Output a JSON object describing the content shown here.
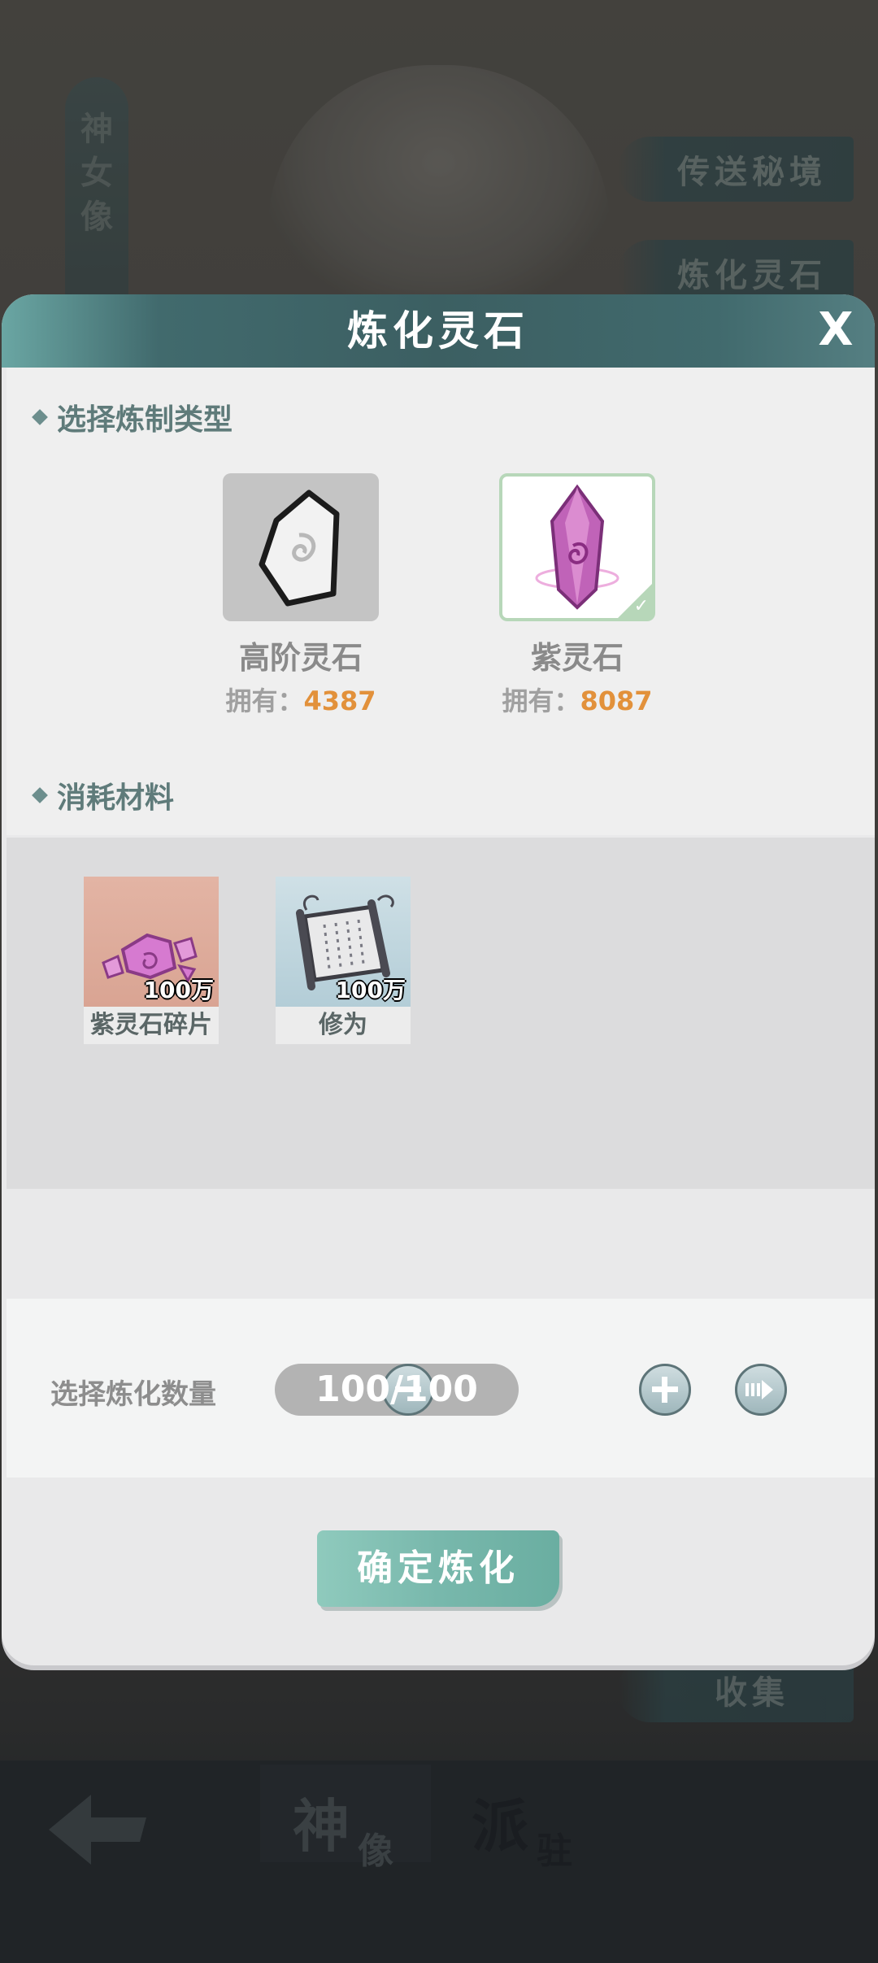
{
  "background": {
    "vertical_tab": [
      "神",
      "女",
      "像"
    ],
    "side_buttons": [
      "传送秘境",
      "炼化灵石",
      "收集"
    ],
    "bottom_tabs": [
      {
        "big": "神",
        "small": "像"
      },
      {
        "big": "派",
        "small": "驻"
      }
    ]
  },
  "dialog": {
    "title": "炼化灵石",
    "close_symbol": "X",
    "section_type": "选择炼制类型",
    "stones": [
      {
        "name": "高阶灵石",
        "owned_label": "拥有：",
        "owned": "4387",
        "selected": false,
        "icon": "white-stone-icon"
      },
      {
        "name": "紫灵石",
        "owned_label": "拥有：",
        "owned": "8087",
        "selected": true,
        "icon": "purple-crystal-icon"
      }
    ],
    "section_materials": "消耗材料",
    "materials": [
      {
        "name": "紫灵石碎片",
        "qty": "100万",
        "icon": "purple-shards-icon"
      },
      {
        "name": "修为",
        "qty": "100万",
        "icon": "scroll-icon"
      }
    ],
    "quantity_label": "选择炼化数量",
    "quantity_value": "100/100",
    "confirm_label": "确定炼化"
  },
  "colors": {
    "header": "#3c5f62",
    "accent_orange": "#e2913b",
    "confirm": "#78b8ac",
    "selected_border": "#b7d7b9"
  }
}
